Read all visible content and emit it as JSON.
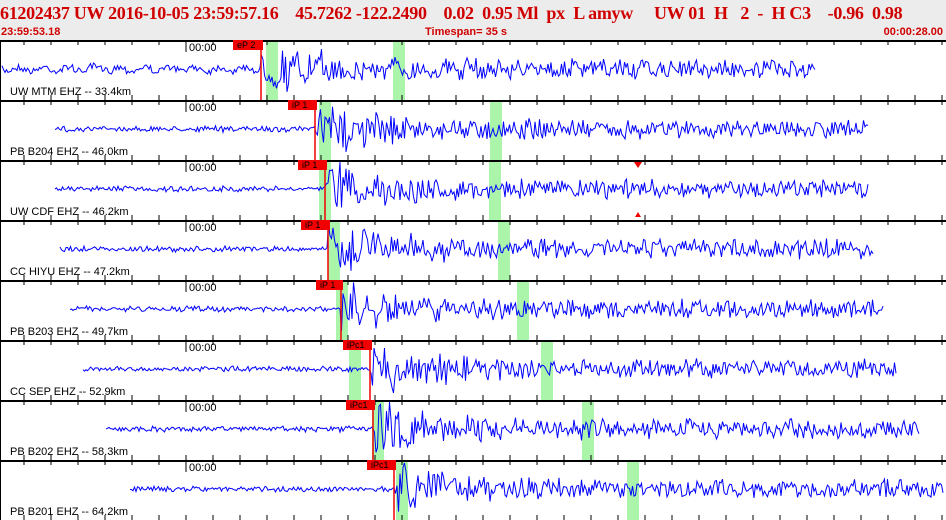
{
  "header": {
    "event_line": "61202437 UW 2016-10-05 23:59:57.16    45.7262 -122.2490    0.02  0.95 Ml  px  L amyw     UW 01  H   2  -  H C3    -0.96  0.98",
    "start_time": "23:59:53.18",
    "timespan": "Timespan=  35 s",
    "end_offset": "00:00:28.00"
  },
  "traces": [
    {
      "label": "UW MTM EHZ -- 33.4km",
      "zero": "00:00",
      "pick": "eP 2"
    },
    {
      "label": "PB B204 EHZ -- 46.0km",
      "zero": "00:00",
      "pick": "iP 1"
    },
    {
      "label": "UW CDF EHZ -- 46.2km",
      "zero": "00:00",
      "pick": "iP 1"
    },
    {
      "label": "CC HIYU EHZ -- 47.2km",
      "zero": "00:00",
      "pick": "iP 1"
    },
    {
      "label": "PB B203 EHZ -- 49.7km",
      "zero": "00:00",
      "pick": "iP 1"
    },
    {
      "label": "CC SEP EHZ -- 52.9km",
      "zero": "00:00",
      "pick": "iPc1"
    },
    {
      "label": "PB B202 EHZ -- 58.3km",
      "zero": "00:00",
      "pick": "iPc1"
    },
    {
      "label": "PB B201 EHZ -- 64.2km",
      "zero": "00:00",
      "pick": "iPc1"
    }
  ],
  "colors": {
    "waveform": "#0000ff",
    "pick": "#f00000",
    "window": "#aaf5aa",
    "header_text": "#d00000"
  }
}
